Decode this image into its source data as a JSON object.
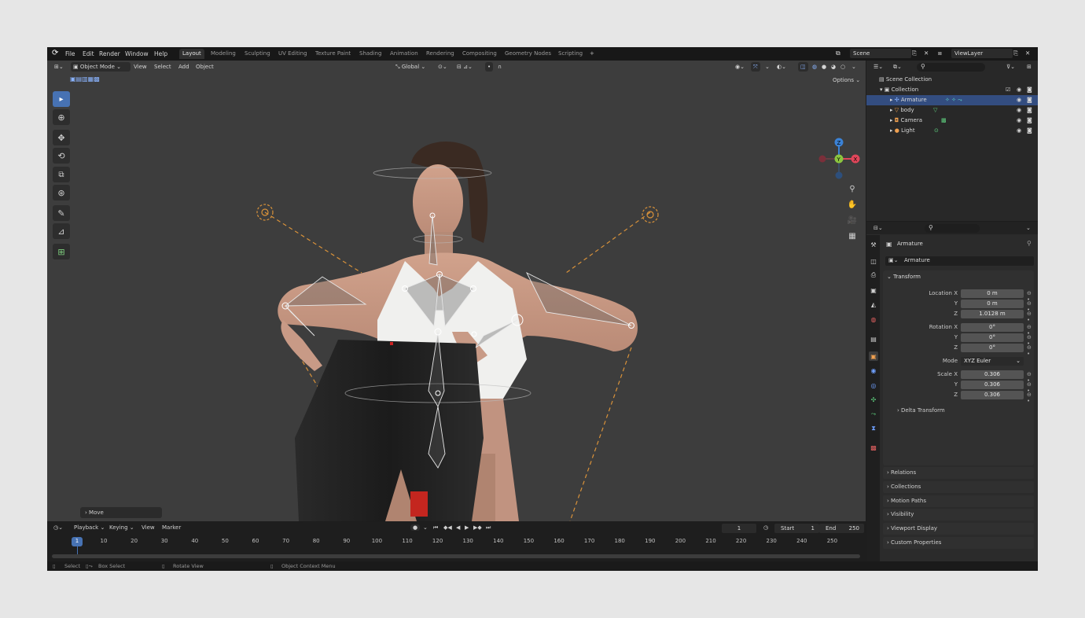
{
  "topbar": {
    "menu": [
      "File",
      "Edit",
      "Render",
      "Window",
      "Help"
    ],
    "workspaces": [
      "Layout",
      "Modeling",
      "Sculpting",
      "UV Editing",
      "Texture Paint",
      "Shading",
      "Animation",
      "Rendering",
      "Compositing",
      "Geometry Nodes",
      "Scripting"
    ],
    "add_tab": "+",
    "scene": "Scene",
    "view_layer": "ViewLayer"
  },
  "viewport_header": {
    "mode": "Object Mode",
    "menus": [
      "View",
      "Select",
      "Add",
      "Object"
    ],
    "transform_orientation": "Global",
    "options": "Options"
  },
  "gizmo": {
    "z": "Z",
    "y": "Y",
    "x": "X"
  },
  "move_panel": {
    "label": "Move"
  },
  "outliner": {
    "scene_collection": "Scene Collection",
    "collection": "Collection",
    "items": [
      {
        "name": "Armature",
        "selected": true
      },
      {
        "name": "body",
        "selected": false
      },
      {
        "name": "Camera",
        "selected": false
      },
      {
        "name": "Light",
        "selected": false
      }
    ]
  },
  "properties": {
    "object_name": "Armature",
    "data_name": "Armature",
    "transform_title": "Transform",
    "location": {
      "label_x": "Location X",
      "label_y": "Y",
      "label_z": "Z",
      "x": "0 m",
      "y": "0 m",
      "z": "1.0128 m"
    },
    "rotation": {
      "label_x": "Rotation X",
      "label_y": "Y",
      "label_z": "Z",
      "x": "0°",
      "y": "0°",
      "z": "0°"
    },
    "mode": {
      "label": "Mode",
      "value": "XYZ Euler"
    },
    "scale": {
      "label_x": "Scale X",
      "label_y": "Y",
      "label_z": "Z",
      "x": "0.306",
      "y": "0.306",
      "z": "0.306"
    },
    "delta_transform": "Delta Transform",
    "sections": [
      "Relations",
      "Collections",
      "Motion Paths",
      "Visibility",
      "Viewport Display",
      "Custom Properties"
    ]
  },
  "timeline": {
    "menus": [
      "Playback",
      "Keying",
      "View",
      "Marker"
    ],
    "current_frame": "1",
    "start_label": "Start",
    "start": "1",
    "end_label": "End",
    "end": "250",
    "frames": [
      "1",
      "10",
      "20",
      "30",
      "40",
      "50",
      "60",
      "70",
      "80",
      "90",
      "100",
      "110",
      "120",
      "130",
      "140",
      "150",
      "160",
      "170",
      "180",
      "190",
      "200",
      "210",
      "220",
      "230",
      "240",
      "250"
    ]
  },
  "statusbar": {
    "select": "Select",
    "box_select": "Box Select",
    "rotate_view": "Rotate View",
    "context_menu": "Object Context Menu"
  },
  "colors": {
    "accent": "#4772b3",
    "selected_row": "#334d80",
    "axis_x": "#e0465a",
    "axis_y": "#8bc53f",
    "axis_z": "#3b82d6"
  }
}
